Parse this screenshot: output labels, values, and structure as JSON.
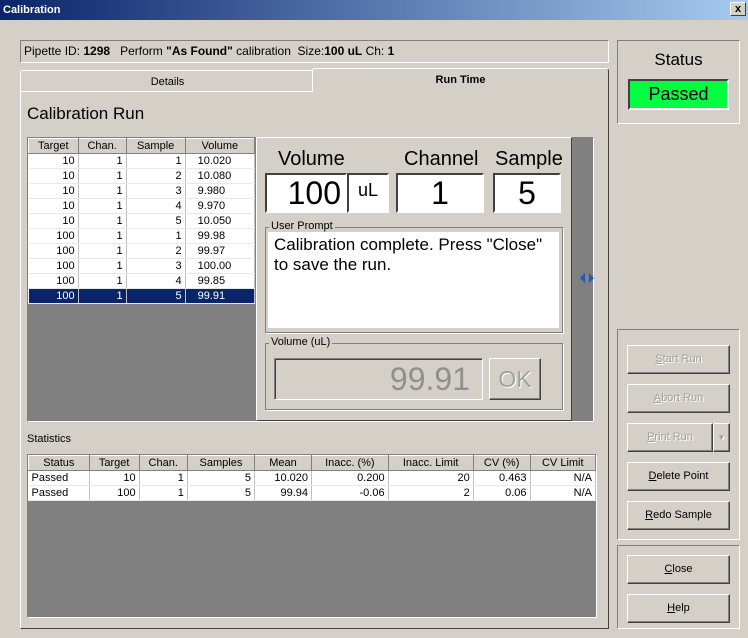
{
  "window": {
    "title": "Calibration",
    "close_glyph": "x"
  },
  "info": {
    "pipette_label": "Pipette ID:",
    "pipette_id": "1298",
    "perform_label": "Perform",
    "mode": "\"As Found\"",
    "calibration_word": "calibration",
    "size_label": "Size:",
    "size_value": "100 uL",
    "ch_label": "Ch:",
    "ch_value": "1"
  },
  "tabs": [
    {
      "label": "Details"
    },
    {
      "label": "Run Time"
    }
  ],
  "run": {
    "heading": "Calibration Run",
    "columns": [
      "Target",
      "Chan.",
      "Sample",
      "Volume"
    ],
    "rows": [
      [
        "10",
        "1",
        "1",
        "10.020"
      ],
      [
        "10",
        "1",
        "2",
        "10.080"
      ],
      [
        "10",
        "1",
        "3",
        "9.980"
      ],
      [
        "10",
        "1",
        "4",
        "9.970"
      ],
      [
        "10",
        "1",
        "5",
        "10.050"
      ],
      [
        "100",
        "1",
        "1",
        "99.98"
      ],
      [
        "100",
        "1",
        "2",
        "99.97"
      ],
      [
        "100",
        "1",
        "3",
        "100.00"
      ],
      [
        "100",
        "1",
        "4",
        "99.85"
      ],
      [
        "100",
        "1",
        "5",
        "99.91"
      ]
    ],
    "selected_row": 9
  },
  "panel": {
    "volume_label": "Volume",
    "channel_label": "Channel",
    "sample_label": "Sample",
    "volume_value": "100",
    "volume_unit": "uL",
    "channel_value": "1",
    "sample_value": "5",
    "prompt_label": "User Prompt",
    "prompt_text": "Calibration complete.  Press \"Close\" to save the run.",
    "reading_label": "Volume (uL)",
    "reading_value": "99.91",
    "ok_label": "OK"
  },
  "statistics": {
    "label": "Statistics",
    "columns": [
      "Status",
      "Target",
      "Chan.",
      "Samples",
      "Mean",
      "Inacc. (%)",
      "Inacc. Limit",
      "CV (%)",
      "CV Limit"
    ],
    "rows": [
      [
        "Passed",
        "10",
        "1",
        "5",
        "10.020",
        "0.200",
        "20",
        "0.463",
        "N/A"
      ],
      [
        "Passed",
        "100",
        "1",
        "5",
        "99.94",
        "-0.06",
        "2",
        "0.06",
        "N/A"
      ]
    ]
  },
  "status": {
    "title": "Status",
    "value": "Passed",
    "color": "#00ff40"
  },
  "buttons": {
    "start_run": {
      "label": "Start Run",
      "u": "S"
    },
    "abort_run": {
      "label": "Abort Run",
      "u": "A"
    },
    "print_run": {
      "label": "Print Run",
      "u": "P"
    },
    "delete_point": {
      "label": "Delete Point",
      "u": "D"
    },
    "redo_sample": {
      "label": "Redo Sample",
      "u": "R"
    },
    "close": {
      "label": "Close",
      "u": "C"
    },
    "help": {
      "label": "Help",
      "u": "H"
    }
  }
}
